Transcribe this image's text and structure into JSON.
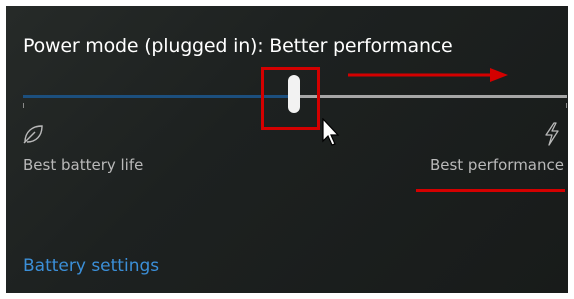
{
  "power_mode": {
    "title": "Power mode (plugged in): Better performance",
    "slider": {
      "level_fraction": 0.5,
      "min_label": "Best battery life",
      "max_label": "Best performance",
      "min_icon": "leaf-icon",
      "max_icon": "lightning-bolt-icon"
    },
    "link_label": "Battery settings"
  },
  "colors": {
    "background": "#1d2120",
    "track_filled": "#1c4f7e",
    "track_empty": "#a6a6a6",
    "thumb": "#f2f2f2",
    "link": "#3b8fd8",
    "annotation_red": "#d40000"
  }
}
